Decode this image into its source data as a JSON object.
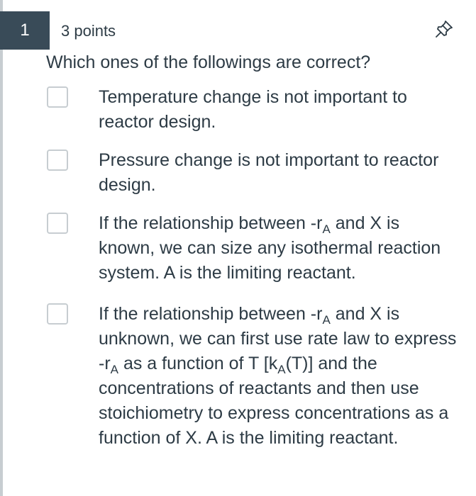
{
  "question": {
    "number": "1",
    "points": "3 points",
    "prompt": "Which ones of the followings are correct?",
    "pin_icon": "pin-icon"
  },
  "options": [
    {
      "text": "Temperature change is not important to reactor design."
    },
    {
      "text": "Pressure change is not important to reactor design."
    },
    {
      "p1": "If the relationship between -r",
      "sub1": "A",
      "p2": " and X is known, we can size any isothermal reaction system. A is the limiting reactant."
    },
    {
      "p1": "If the relationship between -r",
      "sub1": "A",
      "p2": " and X is unknown, we can first use rate law to express -r",
      "sub2": "A",
      "p3": " as a function of T [k",
      "sub3": "A",
      "p4": "(T)] and the concentrations of reactants and then use stoichiometry to express concentrations as a function of X. A is the limiting reactant."
    }
  ]
}
